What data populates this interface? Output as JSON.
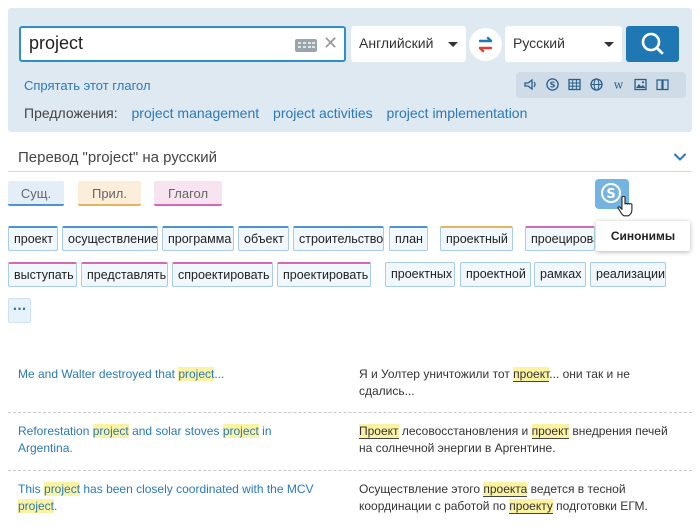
{
  "search": {
    "query": "project"
  },
  "languages": {
    "source": "Английский",
    "target": "Русский"
  },
  "hide_verb_link": "Спрятать этот глагол",
  "suggestions": {
    "label": "Предложения:",
    "items": [
      "project management",
      "project activities",
      "project implementation"
    ]
  },
  "translation_header": "Перевод \"project\" на русский",
  "pos_tabs": [
    {
      "label": "Сущ.",
      "color": "#4e92d0",
      "bg": "#e4eef8"
    },
    {
      "label": "Прил.",
      "color": "#e8b25e",
      "bg": "#fbefdb"
    },
    {
      "label": "Глагол",
      "color": "#d469b4",
      "bg": "#f8e3f1"
    }
  ],
  "tooltip": "Синонимы",
  "translations_row1": [
    "проект",
    "осуществление",
    "программа",
    "объект",
    "строительство",
    "план",
    "проектный",
    "проецировать"
  ],
  "translations_row2": [
    "выступать",
    "представлять",
    "спроектировать",
    "проектировать",
    "проектных",
    "проектной",
    "рамках",
    "реализации"
  ],
  "more_label": "···",
  "examples": [
    {
      "src": [
        [
          "Me and Walter destroyed that ",
          false
        ],
        [
          "project",
          true
        ],
        [
          "...",
          false
        ]
      ],
      "tgt": [
        [
          "Я и Уолтер уничтожили тот ",
          false
        ],
        [
          "проект",
          true
        ],
        [
          "... они так и не сдались...",
          false
        ]
      ]
    },
    {
      "src": [
        [
          "Reforestation ",
          false
        ],
        [
          "project",
          true
        ],
        [
          " and solar stoves ",
          false
        ],
        [
          "project",
          true
        ],
        [
          " in Argentina.",
          false
        ]
      ],
      "tgt": [
        [
          "Проект",
          true
        ],
        [
          " лесовосстановления и ",
          false
        ],
        [
          "проект",
          true
        ],
        [
          " внедрения печей на солнечной энергии в Аргентине.",
          false
        ]
      ]
    },
    {
      "src": [
        [
          "This ",
          false
        ],
        [
          "project",
          true
        ],
        [
          " has been closely coordinated with the MCV ",
          false
        ],
        [
          "project",
          true
        ],
        [
          ".",
          false
        ]
      ],
      "tgt": [
        [
          "Осуществление этого ",
          false
        ],
        [
          "проекта",
          true
        ],
        [
          " ведется в тесной координации с работой по ",
          false
        ],
        [
          "проекту",
          true
        ],
        [
          " подготовки ЕГМ.",
          false
        ]
      ]
    }
  ],
  "colors": {
    "accent": "#1f78b4",
    "link": "#2a79b8",
    "highlight": "#fbf3a2",
    "panel": "#dfe9f2"
  }
}
